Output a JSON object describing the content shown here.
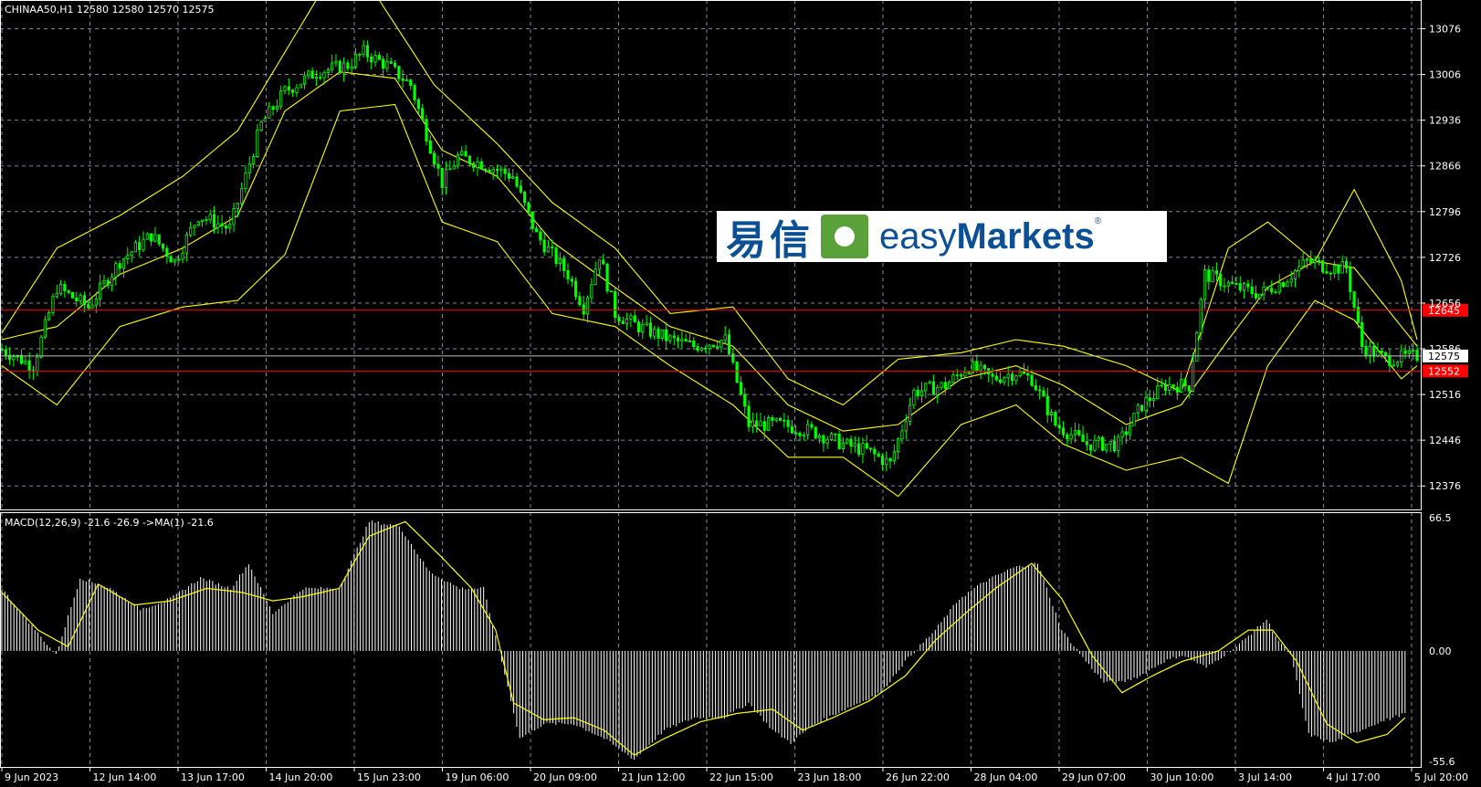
{
  "header": {
    "symbol_line": "CHINAA50,H1  12580 12580 12570 12575",
    "macd_line": "MACD(12,26,9) -21.6 -26.9  ->MA(1) -21.6"
  },
  "logo": {
    "cn": "易信",
    "en_light": "easy",
    "en_bold": "Markets",
    "reg": "®"
  },
  "colors": {
    "background": "#000000",
    "candles": "#00ff00",
    "bands": "#ffff00",
    "macd_hist": "#ffffff",
    "macd_signal": "#ffff00",
    "hline": "#ff0000",
    "grid": "#7f8a8f"
  },
  "chart_data": [
    {
      "type": "candlestick",
      "title": "CHINAA50,H1",
      "ohlc_last": {
        "open": 12580,
        "high": 12580,
        "low": 12570,
        "close": 12575
      },
      "price_ticks": [
        13076,
        13006,
        12936,
        12866,
        12796,
        12726,
        12656,
        12586,
        12516,
        12446,
        12376
      ],
      "ylim": [
        12340,
        13120
      ],
      "time_labels": [
        "9 Jun 2023",
        "12 Jun 14:00",
        "13 Jun 17:00",
        "14 Jun 20:00",
        "15 Jun 23:00",
        "19 Jun 06:00",
        "20 Jun 09:00",
        "21 Jun 12:00",
        "22 Jun 15:00",
        "23 Jun 18:00",
        "26 Jun 22:00",
        "28 Jun 04:00",
        "29 Jun 07:00",
        "30 Jun 10:00",
        "3 Jul 14:00",
        "4 Jul 17:00",
        "5 Jul 20:00"
      ],
      "close_path": [
        [
          0,
          12585
        ],
        [
          8,
          12560
        ],
        [
          14,
          12680
        ],
        [
          22,
          12650
        ],
        [
          30,
          12720
        ],
        [
          38,
          12760
        ],
        [
          44,
          12720
        ],
        [
          50,
          12790
        ],
        [
          58,
          12770
        ],
        [
          66,
          12930
        ],
        [
          72,
          12980
        ],
        [
          80,
          13010
        ],
        [
          88,
          13020
        ],
        [
          92,
          13040
        ],
        [
          98,
          13020
        ],
        [
          104,
          12990
        ],
        [
          112,
          12840
        ],
        [
          116,
          12880
        ],
        [
          122,
          12870
        ],
        [
          130,
          12850
        ],
        [
          136,
          12760
        ],
        [
          144,
          12700
        ],
        [
          148,
          12650
        ],
        [
          152,
          12730
        ],
        [
          156,
          12640
        ],
        [
          162,
          12620
        ],
        [
          170,
          12600
        ],
        [
          176,
          12590
        ],
        [
          184,
          12600
        ],
        [
          190,
          12470
        ],
        [
          198,
          12470
        ],
        [
          206,
          12460
        ],
        [
          214,
          12440
        ],
        [
          220,
          12430
        ],
        [
          226,
          12410
        ],
        [
          232,
          12520
        ],
        [
          240,
          12530
        ],
        [
          246,
          12560
        ],
        [
          252,
          12540
        ],
        [
          258,
          12550
        ],
        [
          262,
          12540
        ],
        [
          268,
          12470
        ],
        [
          276,
          12440
        ],
        [
          284,
          12440
        ],
        [
          290,
          12500
        ],
        [
          296,
          12530
        ],
        [
          302,
          12530
        ],
        [
          306,
          12700
        ],
        [
          314,
          12680
        ],
        [
          320,
          12670
        ],
        [
          326,
          12690
        ],
        [
          332,
          12720
        ],
        [
          338,
          12710
        ],
        [
          342,
          12710
        ],
        [
          346,
          12590
        ],
        [
          352,
          12570
        ],
        [
          360,
          12575
        ]
      ],
      "bollinger": {
        "upper": [
          [
            0,
            12610
          ],
          [
            14,
            12740
          ],
          [
            30,
            12790
          ],
          [
            46,
            12850
          ],
          [
            60,
            12920
          ],
          [
            72,
            13040
          ],
          [
            80,
            13120
          ],
          [
            96,
            13120
          ],
          [
            110,
            12990
          ],
          [
            126,
            12900
          ],
          [
            140,
            12810
          ],
          [
            156,
            12740
          ],
          [
            170,
            12640
          ],
          [
            186,
            12650
          ],
          [
            200,
            12540
          ],
          [
            214,
            12500
          ],
          [
            228,
            12570
          ],
          [
            244,
            12580
          ],
          [
            258,
            12600
          ],
          [
            270,
            12590
          ],
          [
            286,
            12560
          ],
          [
            300,
            12520
          ],
          [
            312,
            12740
          ],
          [
            322,
            12780
          ],
          [
            334,
            12720
          ],
          [
            344,
            12830
          ],
          [
            356,
            12690
          ],
          [
            360,
            12600
          ]
        ],
        "middle": [
          [
            0,
            12600
          ],
          [
            14,
            12620
          ],
          [
            30,
            12700
          ],
          [
            46,
            12740
          ],
          [
            60,
            12790
          ],
          [
            72,
            12950
          ],
          [
            86,
            13010
          ],
          [
            100,
            13000
          ],
          [
            112,
            12890
          ],
          [
            126,
            12850
          ],
          [
            140,
            12750
          ],
          [
            156,
            12680
          ],
          [
            170,
            12620
          ],
          [
            186,
            12590
          ],
          [
            200,
            12500
          ],
          [
            214,
            12460
          ],
          [
            228,
            12470
          ],
          [
            244,
            12540
          ],
          [
            258,
            12560
          ],
          [
            270,
            12530
          ],
          [
            286,
            12470
          ],
          [
            300,
            12500
          ],
          [
            312,
            12600
          ],
          [
            322,
            12680
          ],
          [
            334,
            12720
          ],
          [
            344,
            12710
          ],
          [
            356,
            12620
          ],
          [
            360,
            12590
          ]
        ],
        "lower": [
          [
            0,
            12560
          ],
          [
            14,
            12500
          ],
          [
            30,
            12620
          ],
          [
            46,
            12650
          ],
          [
            60,
            12660
          ],
          [
            72,
            12730
          ],
          [
            86,
            12950
          ],
          [
            100,
            12960
          ],
          [
            112,
            12780
          ],
          [
            126,
            12750
          ],
          [
            140,
            12640
          ],
          [
            156,
            12620
          ],
          [
            170,
            12560
          ],
          [
            186,
            12500
          ],
          [
            200,
            12420
          ],
          [
            214,
            12420
          ],
          [
            228,
            12360
          ],
          [
            244,
            12470
          ],
          [
            258,
            12500
          ],
          [
            270,
            12440
          ],
          [
            286,
            12400
          ],
          [
            300,
            12420
          ],
          [
            312,
            12380
          ],
          [
            322,
            12560
          ],
          [
            334,
            12660
          ],
          [
            344,
            12630
          ],
          [
            356,
            12540
          ],
          [
            360,
            12560
          ]
        ]
      },
      "horizontal_lines": [
        {
          "price": 12645,
          "label": "12645",
          "color": "#ff0000"
        },
        {
          "price": 12552,
          "label": "12552",
          "color": "#ff0000"
        },
        {
          "price": 12575,
          "label": "12575",
          "color": "#c0c0c0",
          "current": true
        }
      ]
    },
    {
      "type": "histogram",
      "title": "MACD(12,26,9)",
      "values_last": {
        "macd": -21.6,
        "signal": -26.9
      },
      "y_ticks": [
        "66.5",
        "0.00",
        "-55.6"
      ],
      "ylim": [
        -55.6,
        66.5
      ],
      "macd": [
        [
          0,
          30
        ],
        [
          10,
          12
        ],
        [
          18,
          -2
        ],
        [
          26,
          35
        ],
        [
          36,
          30
        ],
        [
          46,
          20
        ],
        [
          56,
          25
        ],
        [
          66,
          35
        ],
        [
          76,
          30
        ],
        [
          82,
          42
        ],
        [
          90,
          18
        ],
        [
          100,
          30
        ],
        [
          112,
          30
        ],
        [
          122,
          62
        ],
        [
          132,
          60
        ],
        [
          142,
          38
        ],
        [
          152,
          30
        ],
        [
          160,
          30
        ],
        [
          166,
          -5
        ],
        [
          172,
          -42
        ],
        [
          180,
          -35
        ],
        [
          190,
          -35
        ],
        [
          200,
          -42
        ],
        [
          210,
          -52
        ],
        [
          220,
          -38
        ],
        [
          230,
          -32
        ],
        [
          240,
          -32
        ],
        [
          248,
          -25
        ],
        [
          256,
          -38
        ],
        [
          262,
          -44
        ],
        [
          270,
          -35
        ],
        [
          280,
          -28
        ],
        [
          292,
          -20
        ],
        [
          300,
          -5
        ],
        [
          310,
          10
        ],
        [
          318,
          25
        ],
        [
          326,
          33
        ],
        [
          336,
          40
        ],
        [
          344,
          42
        ],
        [
          352,
          10
        ],
        [
          360,
          -5
        ],
        [
          366,
          -15
        ],
        [
          372,
          -15
        ],
        [
          378,
          -12
        ],
        [
          386,
          -5
        ],
        [
          392,
          -2
        ],
        [
          400,
          -8
        ],
        [
          410,
          2
        ],
        [
          420,
          15
        ],
        [
          424,
          5
        ],
        [
          428,
          -2
        ],
        [
          434,
          -40
        ],
        [
          442,
          -44
        ],
        [
          448,
          -40
        ],
        [
          456,
          -35
        ],
        [
          466,
          -30
        ]
      ],
      "signal": [
        [
          0,
          28
        ],
        [
          12,
          10
        ],
        [
          22,
          2
        ],
        [
          32,
          32
        ],
        [
          44,
          22
        ],
        [
          56,
          24
        ],
        [
          68,
          30
        ],
        [
          80,
          28
        ],
        [
          90,
          24
        ],
        [
          100,
          26
        ],
        [
          112,
          30
        ],
        [
          122,
          55
        ],
        [
          134,
          62
        ],
        [
          146,
          45
        ],
        [
          156,
          30
        ],
        [
          164,
          10
        ],
        [
          170,
          -25
        ],
        [
          180,
          -33
        ],
        [
          190,
          -32
        ],
        [
          200,
          -38
        ],
        [
          210,
          -50
        ],
        [
          220,
          -42
        ],
        [
          232,
          -34
        ],
        [
          244,
          -30
        ],
        [
          256,
          -28
        ],
        [
          266,
          -38
        ],
        [
          276,
          -32
        ],
        [
          288,
          -24
        ],
        [
          300,
          -12
        ],
        [
          310,
          5
        ],
        [
          320,
          18
        ],
        [
          330,
          30
        ],
        [
          342,
          42
        ],
        [
          352,
          25
        ],
        [
          362,
          -2
        ],
        [
          372,
          -20
        ],
        [
          382,
          -12
        ],
        [
          392,
          -5
        ],
        [
          404,
          0
        ],
        [
          414,
          10
        ],
        [
          422,
          10
        ],
        [
          430,
          -5
        ],
        [
          440,
          -35
        ],
        [
          450,
          -44
        ],
        [
          460,
          -40
        ],
        [
          466,
          -32
        ]
      ]
    }
  ]
}
